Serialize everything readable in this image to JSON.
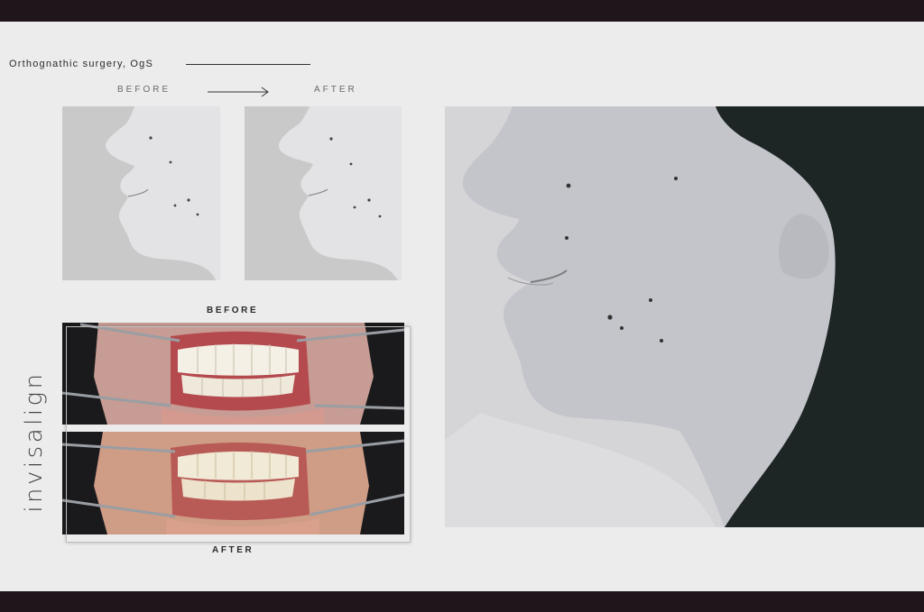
{
  "header": {
    "title": "Orthognathic surgery, OgS"
  },
  "profile_comparison": {
    "before_label": "BEFORE",
    "after_label": "AFTER"
  },
  "intraoral_comparison": {
    "before_label": "BEFORE",
    "after_label": "AFTER"
  },
  "side_label": "invisalign",
  "colors": {
    "band": "#1f161c",
    "background": "#ececed",
    "gum_red": "#b44a4e",
    "hair": "#1a2422"
  }
}
